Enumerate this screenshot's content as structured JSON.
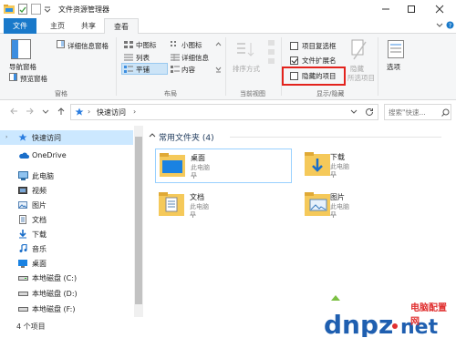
{
  "window": {
    "title": "文件资源管理器",
    "controls": {
      "minimize": "—",
      "maximize": "☐",
      "close": "✕"
    }
  },
  "ribbon": {
    "tabs": [
      "文件",
      "主页",
      "共享",
      "查看"
    ],
    "active_tab": "查看",
    "panes": {
      "label": "窗格",
      "nav_pane": "导航窗格",
      "details_pane": "详细信息窗格",
      "preview_pane": "预览窗格"
    },
    "layout": {
      "label": "布局",
      "items": [
        "中图标",
        "小图标",
        "列表",
        "详细信息",
        "平铺",
        "内容"
      ],
      "selected": "平铺"
    },
    "current_view": {
      "label": "当前视图",
      "sort_by": "排序方式"
    },
    "show_hide": {
      "label": "显示/隐藏",
      "item_checkboxes": "项目复选框",
      "item_checkboxes_checked": false,
      "file_extensions": "文件扩展名",
      "file_extensions_checked": true,
      "hidden_items": "隐藏的项目",
      "hidden_items_checked": false,
      "hide_selected_l1": "隐藏",
      "hide_selected_l2": "所选项目"
    },
    "options": "选项"
  },
  "address": {
    "path": "快速访问",
    "search_placeholder": "搜索\"快速..."
  },
  "nav": {
    "items": [
      {
        "label": "快速访问",
        "icon": "star-icon"
      },
      {
        "label": "OneDrive",
        "icon": "cloud-icon"
      },
      {
        "label": "此电脑",
        "icon": "computer-icon"
      },
      {
        "label": "视频",
        "icon": "video-icon"
      },
      {
        "label": "图片",
        "icon": "picture-icon"
      },
      {
        "label": "文档",
        "icon": "document-icon"
      },
      {
        "label": "下载",
        "icon": "download-icon"
      },
      {
        "label": "音乐",
        "icon": "music-icon"
      },
      {
        "label": "桌面",
        "icon": "desktop-icon"
      },
      {
        "label": "本地磁盘 (C:)",
        "icon": "drive-icon"
      },
      {
        "label": "本地磁盘 (D:)",
        "icon": "drive-icon"
      },
      {
        "label": "本地磁盘 (F:)",
        "icon": "drive-icon"
      }
    ]
  },
  "content": {
    "section_title": "常用文件夹 (4)",
    "folders": [
      {
        "name": "桌面",
        "location": "此电脑"
      },
      {
        "name": "下载",
        "location": "此电脑"
      },
      {
        "name": "文档",
        "location": "此电脑"
      },
      {
        "name": "图片",
        "location": "此电脑"
      }
    ]
  },
  "status": {
    "count": "4 个项目"
  },
  "watermark": {
    "brand": "电脑配置网",
    "domain": "dnpz.net"
  },
  "colors": {
    "accent": "#1979ca",
    "selection": "#cce8ff",
    "highlight_box": "#e3231d",
    "folder": "#f5c95a"
  }
}
